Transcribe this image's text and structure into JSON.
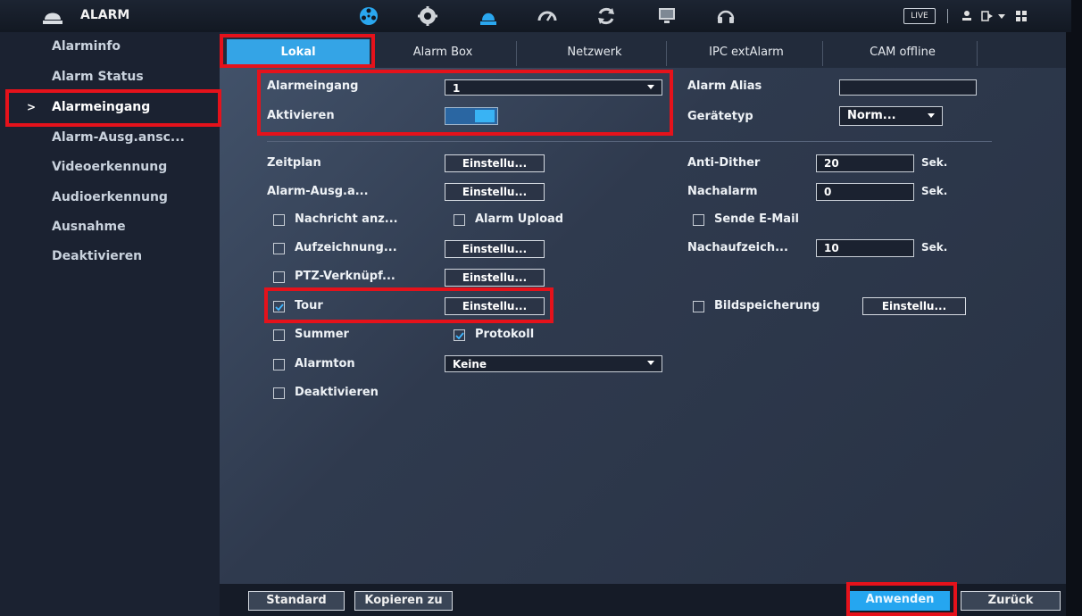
{
  "header": {
    "title": "ALARM",
    "icons": [
      "film-reel-icon",
      "gear-icon",
      "alarm-bell-icon",
      "speedometer-icon",
      "refresh-icon",
      "monitor-icon",
      "headset-icon"
    ],
    "live_label": "LIVE"
  },
  "sidebar": {
    "items": [
      {
        "label": "Alarminfo"
      },
      {
        "label": "Alarm Status"
      },
      {
        "label": "Alarmeingang",
        "active": true
      },
      {
        "label": "Alarm-Ausg.ansc..."
      },
      {
        "label": "Videoerkennung"
      },
      {
        "label": "Audioerkennung"
      },
      {
        "label": "Ausnahme"
      },
      {
        "label": "Deaktivieren"
      }
    ],
    "active_marker": ">"
  },
  "tabs": [
    "Lokal",
    "Alarm Box",
    "Netzwerk",
    "IPC extAlarm",
    "CAM offline"
  ],
  "form": {
    "alarm_input_label": "Alarmeingang",
    "alarm_input_value": "1",
    "enable_label": "Aktivieren",
    "enable_on": true,
    "alias_label": "Alarm Alias",
    "alias_value": "",
    "device_type_label": "Gerätetyp",
    "device_type_value": "Norm...",
    "schedule_label": "Zeitplan",
    "settings_label": "Einstellu...",
    "alarm_out_label": "Alarm-Ausg.a...",
    "anti_dither_label": "Anti-Dither",
    "anti_dither_value": "20",
    "post_alarm_label": "Nachalarm",
    "post_alarm_value": "0",
    "unit_sec": "Sek.",
    "show_message_label": "Nachricht anz...",
    "alarm_upload_label": "Alarm Upload",
    "send_email_label": "Sende E-Mail",
    "record_label": "Aufzeichnung...",
    "post_record_label": "Nachaufzeich...",
    "post_record_value": "10",
    "ptz_label": "PTZ-Verknüpf...",
    "tour_label": "Tour",
    "tour_checked": true,
    "snapshot_label": "Bildspeicherung",
    "buzzer_label": "Summer",
    "log_label": "Protokoll",
    "log_checked": true,
    "alarm_tone_label": "Alarmton",
    "alarm_tone_value": "Keine",
    "disable_label": "Deaktivieren"
  },
  "footer": {
    "default_label": "Standard",
    "copy_label": "Kopieren zu",
    "apply_label": "Anwenden",
    "back_label": "Zurück"
  },
  "colors": {
    "accent": "#34a4e6",
    "highlight": "#e5121b"
  }
}
